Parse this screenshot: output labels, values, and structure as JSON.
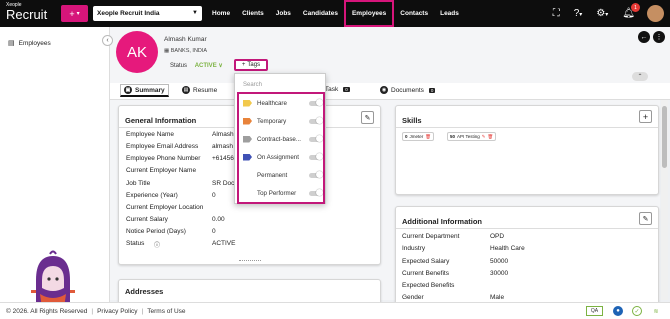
{
  "app": {
    "logo_small": "Xeople",
    "logo_big": "Recruit",
    "company": "Xeople Recruit India"
  },
  "nav": [
    "Home",
    "Clients",
    "Jobs",
    "Candidates",
    "Employees",
    "Contacts",
    "Leads"
  ],
  "nav_active": "Employees",
  "notifications_count": "1",
  "sidebar": {
    "item_label": "Employees"
  },
  "profile": {
    "initials": "AK",
    "name": "Almash Kumar",
    "location": "BANKS, INDIA",
    "status_label": "Status",
    "status_value": "ACTIVE",
    "tags_label": "Tags"
  },
  "tabs": [
    {
      "label": "Summary",
      "count": ""
    },
    {
      "label": "Resume",
      "count": ""
    },
    {
      "label": "g / Task",
      "count": "0"
    },
    {
      "label": "Documents",
      "count": "0"
    }
  ],
  "general_info": {
    "title": "General Information",
    "rows": [
      {
        "k": "Employee Name",
        "v": "Almash"
      },
      {
        "k": "Employee Email Address",
        "v": "almash"
      },
      {
        "k": "Employee Phone Number",
        "v": "+614561"
      },
      {
        "k": "Current Employer Name",
        "v": ""
      },
      {
        "k": "Job Title",
        "v": "SR Doct"
      },
      {
        "k": "Experience (Year)",
        "v": "0"
      },
      {
        "k": "Current Employer Location",
        "v": ""
      },
      {
        "k": "Current Salary",
        "v": "0.00"
      },
      {
        "k": "Notice Period (Days)",
        "v": "0"
      },
      {
        "k": "Status",
        "v": "ACTIVE"
      }
    ]
  },
  "addresses": {
    "title": "Addresses"
  },
  "skills": {
    "title": "Skills",
    "items": [
      {
        "years": "0",
        "name": "Jmeter"
      },
      {
        "years": "50",
        "name": "API Testing"
      }
    ]
  },
  "additional_info": {
    "title": "Additional Information",
    "rows": [
      {
        "k": "Current Department",
        "v": "OPD"
      },
      {
        "k": "Industry",
        "v": "Health Care"
      },
      {
        "k": "Expected Salary",
        "v": "50000"
      },
      {
        "k": "Current Benefits",
        "v": "30000"
      },
      {
        "k": "Expected Benefits",
        "v": ""
      },
      {
        "k": "Gender",
        "v": "Male"
      }
    ]
  },
  "tags_dropdown": {
    "search_placeholder": "Search",
    "items": [
      {
        "label": "Healthcare",
        "color": "#f2c94c"
      },
      {
        "label": "Temporary",
        "color": "#e8833a"
      },
      {
        "label": "Contract-base...",
        "color": "#9e9e9e"
      },
      {
        "label": "On Assignment",
        "color": "#3f51b5"
      },
      {
        "label": "Permanent",
        "color": ""
      },
      {
        "label": "Top Performer",
        "color": ""
      }
    ]
  },
  "footer": {
    "copyright": "© 2026. All Rights Reserved",
    "privacy": "Privacy Policy",
    "terms": "Terms of Use",
    "qa_badge": "QA"
  },
  "colors": {
    "brand_pink": "#d6157a",
    "active_green": "#7cb342",
    "topbar": "#0d0d0d"
  }
}
